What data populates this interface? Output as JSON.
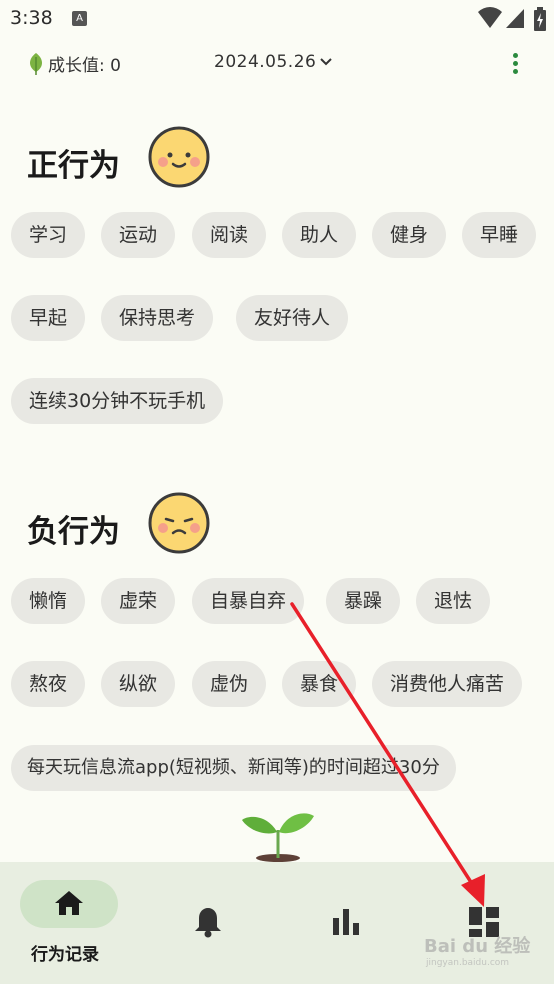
{
  "status_bar": {
    "time": "3:38",
    "notification_badge": "A"
  },
  "header": {
    "growth_label": "成长值: 0",
    "date": "2024.05.26"
  },
  "positive": {
    "title": "正行为",
    "chips": [
      "学习",
      "运动",
      "阅读",
      "助人",
      "健身",
      "早睡",
      "早起",
      "保持思考",
      "友好待人",
      "连续30分钟不玩手机"
    ]
  },
  "negative": {
    "title": "负行为",
    "chips": [
      "懒惰",
      "虚荣",
      "自暴自弃",
      "暴躁",
      "退怯",
      "熬夜",
      "纵欲",
      "虚伪",
      "暴食",
      "消费他人痛苦",
      "每天玩信息流app(短视频、新闻等)的时间超过30分"
    ]
  },
  "bottom_nav": {
    "items": [
      {
        "icon": "home-icon",
        "label": "行为记录",
        "active": true
      },
      {
        "icon": "bell-icon"
      },
      {
        "icon": "bar-chart-icon"
      },
      {
        "icon": "dashboard-icon"
      }
    ]
  },
  "watermark": {
    "text": "Bai du 经验",
    "sub": "jingyan.baidu.com"
  },
  "colors": {
    "accent_green": "#2b8a3e",
    "chip_bg": "#e8e8e3",
    "nav_bg": "#e8eee1",
    "nav_pill": "#cfe3c7",
    "arrow_red": "#e8202a"
  }
}
